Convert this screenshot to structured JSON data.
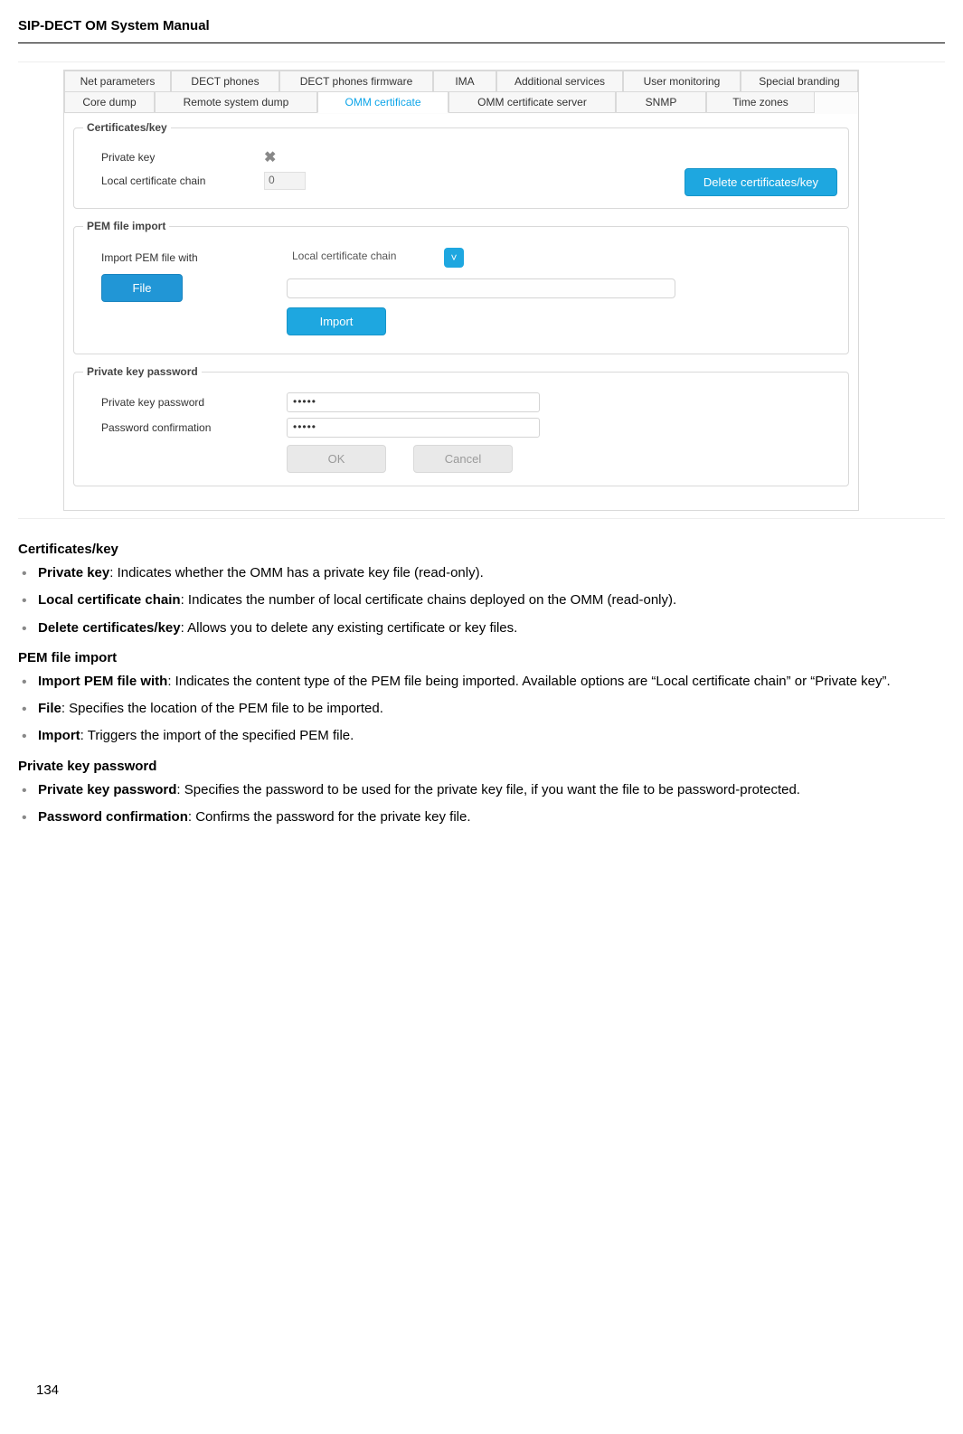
{
  "header": {
    "title": "SIP-DECT OM System Manual"
  },
  "page_number": "134",
  "tabs_row1": [
    {
      "label": "Net parameters",
      "cls": "t-net"
    },
    {
      "label": "DECT phones",
      "cls": "t-dp"
    },
    {
      "label": "DECT phones firmware",
      "cls": "t-dpf"
    },
    {
      "label": "IMA",
      "cls": "t-ima"
    },
    {
      "label": "Additional services",
      "cls": "t-as"
    },
    {
      "label": "User monitoring",
      "cls": "t-um"
    },
    {
      "label": "Special branding",
      "cls": "t-sb"
    }
  ],
  "tabs_row2": [
    {
      "label": "Core dump",
      "cls": "t-cd"
    },
    {
      "label": "Remote system dump",
      "cls": "t-rsd"
    },
    {
      "label": "OMM certificate",
      "cls": "t-oc",
      "active": true
    },
    {
      "label": "OMM certificate server",
      "cls": "t-ocs"
    },
    {
      "label": "SNMP",
      "cls": "t-snmp"
    },
    {
      "label": "Time zones",
      "cls": "t-tz"
    }
  ],
  "certkey": {
    "legend": "Certificates/key",
    "private_key_label": "Private key",
    "local_chain_label": "Local certificate chain",
    "local_chain_value": "0",
    "delete_btn": "Delete certificates/key"
  },
  "pem": {
    "legend": "PEM file import",
    "import_with_label": "Import PEM file with",
    "import_with_value": "Local certificate chain",
    "file_btn": "File",
    "file_path": "",
    "import_btn": "Import"
  },
  "pkpw": {
    "legend": "Private key password",
    "pw_label": "Private key password",
    "pw_value": "•••••",
    "pw_confirm_label": "Password confirmation",
    "pw_confirm_value": "•••••",
    "ok_btn": "OK",
    "cancel_btn": "Cancel"
  },
  "doc": {
    "s1_heading": "Certificates/key",
    "s1": [
      {
        "b": "Private key",
        "t": ": Indicates whether the OMM has a private key file (read-only)."
      },
      {
        "b": "Local certificate chain",
        "t": ": Indicates the number of local certificate chains deployed on the OMM (read-only)."
      },
      {
        "b": "Delete certificates/key",
        "t": ": Allows you to delete any existing certificate or key files."
      }
    ],
    "s2_heading": "PEM file import",
    "s2": [
      {
        "b": "Import PEM file with",
        "t": ": Indicates the content type of the PEM file being imported. Available options are “Local certificate chain” or “Private key”."
      },
      {
        "b": "File",
        "t": ": Specifies the location of the PEM file to be imported."
      },
      {
        "b": "Import",
        "t": ": Triggers the import of the specified PEM file."
      }
    ],
    "s3_heading": "Private key password",
    "s3": [
      {
        "b": "Private key password",
        "t": ": Specifies the password to be used for the private key file, if you want the file to be password-protected."
      },
      {
        "b": "Password confirmation",
        "t": ": Confirms the password for the private key file."
      }
    ]
  }
}
